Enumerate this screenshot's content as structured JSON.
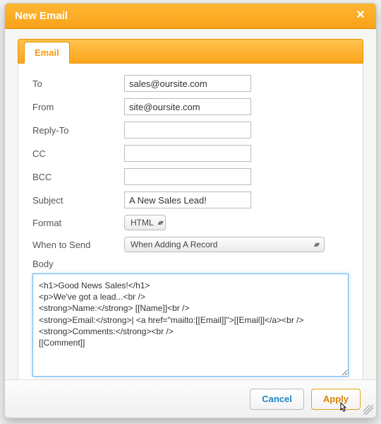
{
  "dialog_title": "New Email",
  "tab_label": "Email",
  "labels": {
    "to": "To",
    "from": "From",
    "reply_to": "Reply-To",
    "cc": "CC",
    "bcc": "BCC",
    "subject": "Subject",
    "format": "Format",
    "when": "When to Send",
    "body": "Body"
  },
  "fields": {
    "to": "sales@oursite.com",
    "from": "site@oursite.com",
    "reply_to": "",
    "cc": "",
    "bcc": "",
    "subject": "A New Sales Lead!"
  },
  "format_selected": "HTML",
  "when_selected": "When Adding A Record",
  "body_text": "<h1>Good News Sales!</h1>\n<p>We've got a lead...<br />\n<strong>Name:</strong> [[Name]]<br />\n<strong>Email:</strong>| <a href=\"mailto:[[Email]]\">[[Email]]</a><br />\n<strong>Comments:</strong><br />\n[[Comment]]",
  "buttons": {
    "cancel": "Cancel",
    "apply": "Apply"
  }
}
